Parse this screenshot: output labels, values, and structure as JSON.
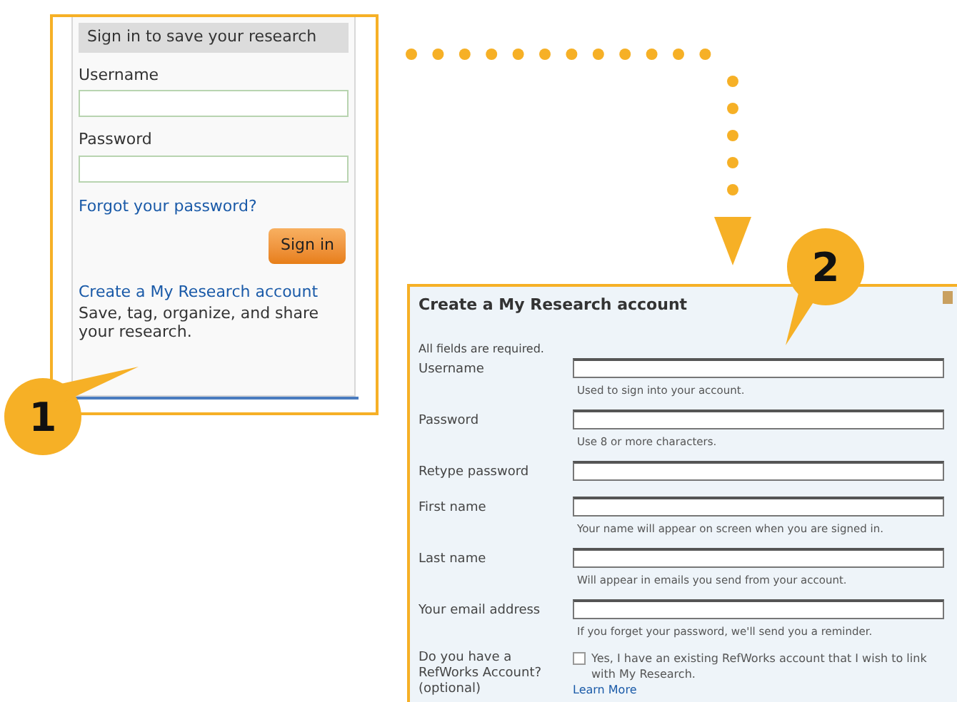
{
  "panel_1": {
    "heading": "Sign in to save your research",
    "fields": [
      {
        "label": "Username"
      },
      {
        "label": "Password"
      }
    ],
    "forgot_link": "Forgot your password?",
    "button": "Sign in",
    "create_link": "Create a My Research account",
    "description": "Save, tag, organize, and share your research."
  },
  "panel_2": {
    "title": "Create a My Research account",
    "note": "All fields are required.",
    "fields": [
      {
        "label": "Username",
        "hint": "Used to sign into your account."
      },
      {
        "label": "Password",
        "hint": "Use 8 or more characters."
      },
      {
        "label": "Retype password"
      },
      {
        "label": "First name",
        "hint": "Your name will appear on screen when you are signed in."
      },
      {
        "label": "Last name",
        "hint": "Will appear in emails you send from your account."
      },
      {
        "label": "Your email address",
        "hint": "If you forget your password, we'll send you a reminder."
      }
    ],
    "refworks": {
      "label": "Do you have a RefWorks Account? (optional)",
      "checked": false,
      "text": "Yes, I have an existing RefWorks account that I wish to link with My Research.",
      "link": "Learn More"
    }
  },
  "callouts": [
    "1",
    "2"
  ]
}
